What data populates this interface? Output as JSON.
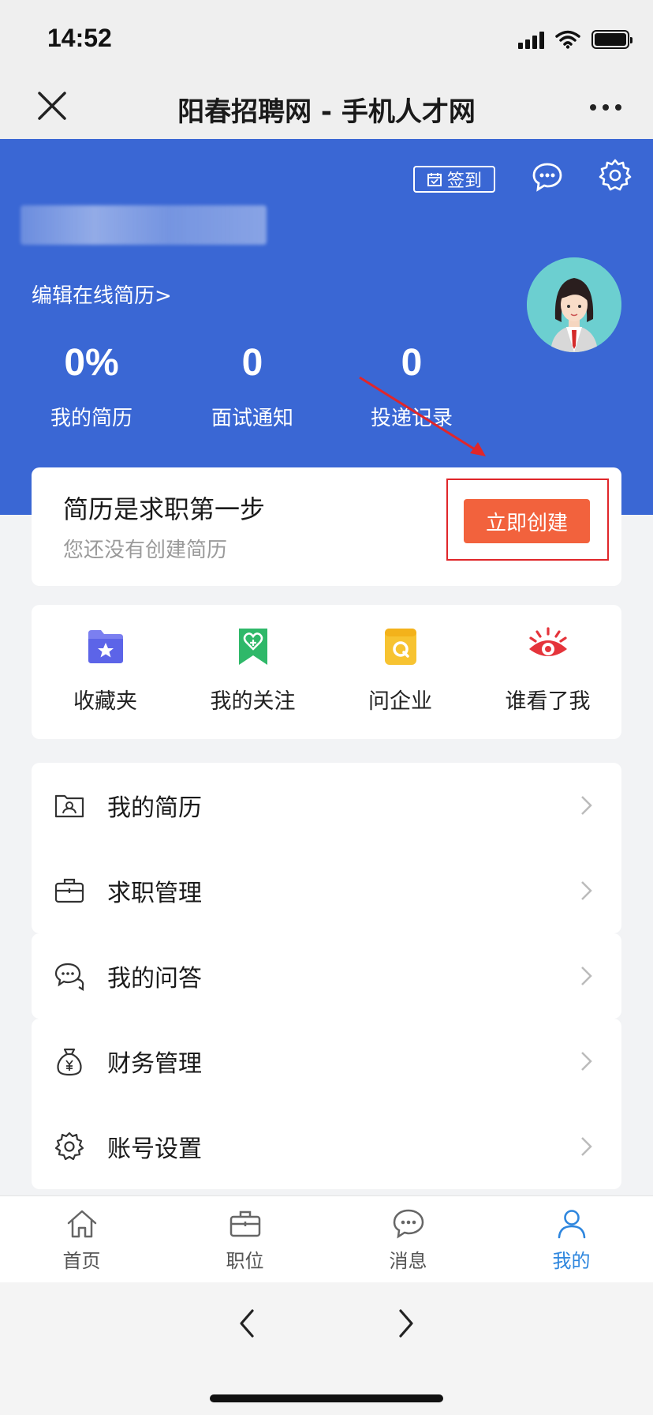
{
  "status_bar": {
    "time": "14:52"
  },
  "nav": {
    "title": "阳春招聘网 - 手机人才网"
  },
  "header": {
    "signin_label": "签到",
    "edit_resume": "编辑在线简历>",
    "stats": [
      {
        "value": "0%",
        "label": "我的简历"
      },
      {
        "value": "0",
        "label": "面试通知"
      },
      {
        "value": "0",
        "label": "投递记录"
      }
    ]
  },
  "resume_card": {
    "title": "简历是求职第一步",
    "subtitle": "您还没有创建简历",
    "button": "立即创建"
  },
  "quick_actions": [
    {
      "label": "收藏夹",
      "icon": "folder-star-icon"
    },
    {
      "label": "我的关注",
      "icon": "bookmark-heart-icon"
    },
    {
      "label": "问企业",
      "icon": "question-folder-icon"
    },
    {
      "label": "谁看了我",
      "icon": "eye-icon"
    }
  ],
  "menu": [
    {
      "label": "我的简历",
      "icon": "resume-icon"
    },
    {
      "label": "求职管理",
      "icon": "briefcase-icon"
    },
    {
      "label": "我的问答",
      "icon": "chat-bubbles-icon"
    },
    {
      "label": "财务管理",
      "icon": "money-bag-icon"
    },
    {
      "label": "账号设置",
      "icon": "settings-icon"
    }
  ],
  "tabs": [
    {
      "label": "首页",
      "icon": "home-icon"
    },
    {
      "label": "职位",
      "icon": "briefcase-icon"
    },
    {
      "label": "消息",
      "icon": "message-icon"
    },
    {
      "label": "我的",
      "icon": "user-icon",
      "active": true
    }
  ],
  "colors": {
    "header_blue": "#3a67d4",
    "create_button": "#f2623d",
    "highlight_red": "#e0262a",
    "tab_active": "#2e86de"
  }
}
